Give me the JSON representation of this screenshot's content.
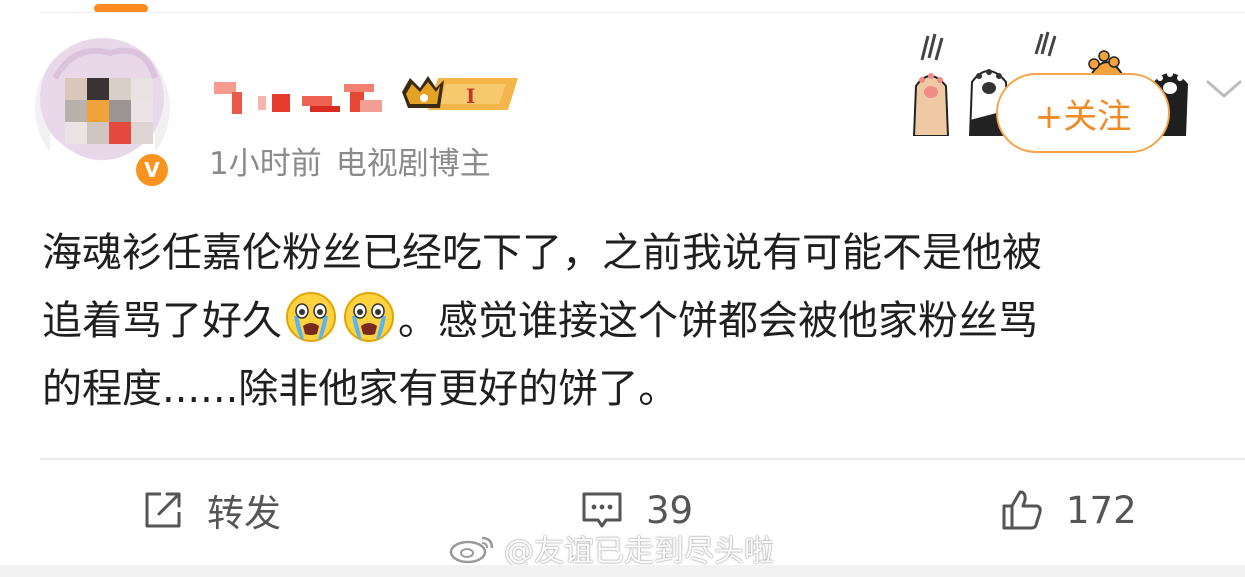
{
  "post": {
    "author": {
      "name": "",
      "verified_badge": "V",
      "time": "1小时前",
      "role": "电视剧博主"
    },
    "follow_label": "+关注",
    "text_lines": [
      "海魂衫任嘉伦粉丝已经吃下了，之前我说有可能不是他被",
      "追着骂了好久",
      "。感觉谁接这个饼都会被他家粉丝骂",
      "的程度......除非他家有更好的饼了。"
    ],
    "emojis": [
      "crying-emoji",
      "crying-emoji"
    ]
  },
  "actions": {
    "repost_label": "转发",
    "comment_count": "39",
    "like_count": "172"
  },
  "watermark": "@友谊已走到尽头啦",
  "colors": {
    "accent": "#f08b25",
    "follow_border": "#f4a44a",
    "meta_text": "#8b8b8b",
    "body_text": "#1f1f1f"
  }
}
